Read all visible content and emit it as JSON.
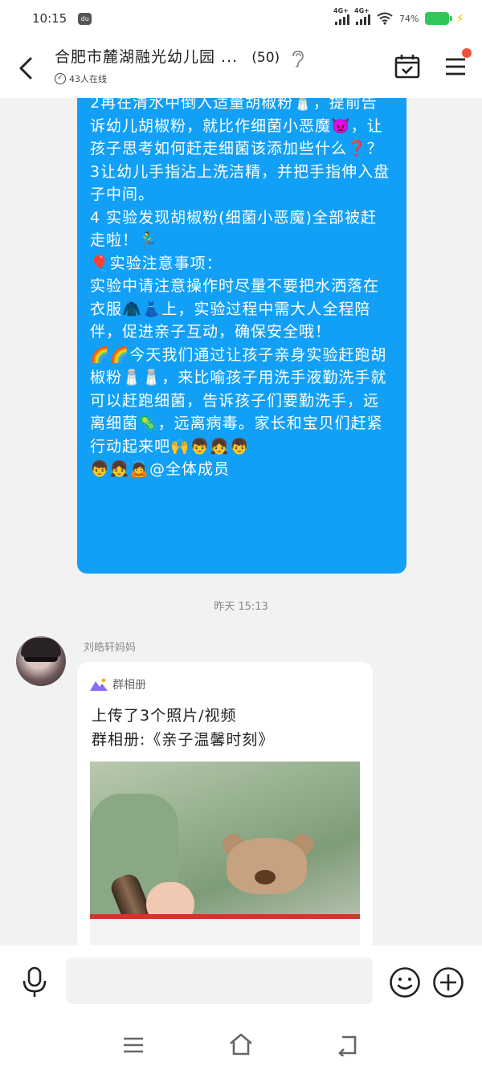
{
  "status_bar": {
    "time": "10:15",
    "app_icon_text": "du",
    "network1": "4G+",
    "network2": "4G+",
    "battery_percent": "74%"
  },
  "header": {
    "title": "合肥市麓湖融光幼儿园 ...",
    "member_count": "(50)",
    "online": "43人在线"
  },
  "message_blue": {
    "text": "2再在清水中倒入适量胡椒粉🧂，提前告诉幼儿胡椒粉，就比作细菌小恶魔👿，让孩子思考如何赶走细菌该添加些什么❓？\n3让幼儿手指沾上洗洁精，并把手指伸入盘子中间。\n4 实验发现胡椒粉(细菌小恶魔)全部被赶走啦！🏃‍♂️\n🎈实验注意事项：\n实验中请注意操作时尽量不要把水洒落在衣服🧥👗上，实验过程中需大人全程陪伴，促进亲子互动，确保安全哦！\n🌈🌈今天我们通过让孩子亲身实验赶跑胡椒粉🧂🧂，来比喻孩子用洗手液勤洗手就可以赶跑细菌，告诉孩子们要勤洗手，远离细菌🦠，远离病毒。家长和宝贝们赶紧行动起来吧🙌👦👧👦\n👦👧🙇@全体成员"
  },
  "time_divider": "昨天 15:13",
  "message_album": {
    "sender": "刘皓轩妈妈",
    "card_label": "群相册",
    "line1": "上传了3个照片/视频",
    "line2": "群相册:《亲子温馨时刻》"
  },
  "input": {
    "value": "",
    "placeholder": ""
  },
  "icons": {
    "back": "back-arrow-icon",
    "ear": "ear-icon",
    "calendar": "calendar-check-icon",
    "menu": "hamburger-menu-icon",
    "mic": "microphone-icon",
    "emoji": "smiley-icon",
    "plus": "plus-circle-icon"
  },
  "colors": {
    "bubble_blue": "#12a0f7",
    "notification_dot": "#f24f3c",
    "battery_green": "#32c55a"
  }
}
